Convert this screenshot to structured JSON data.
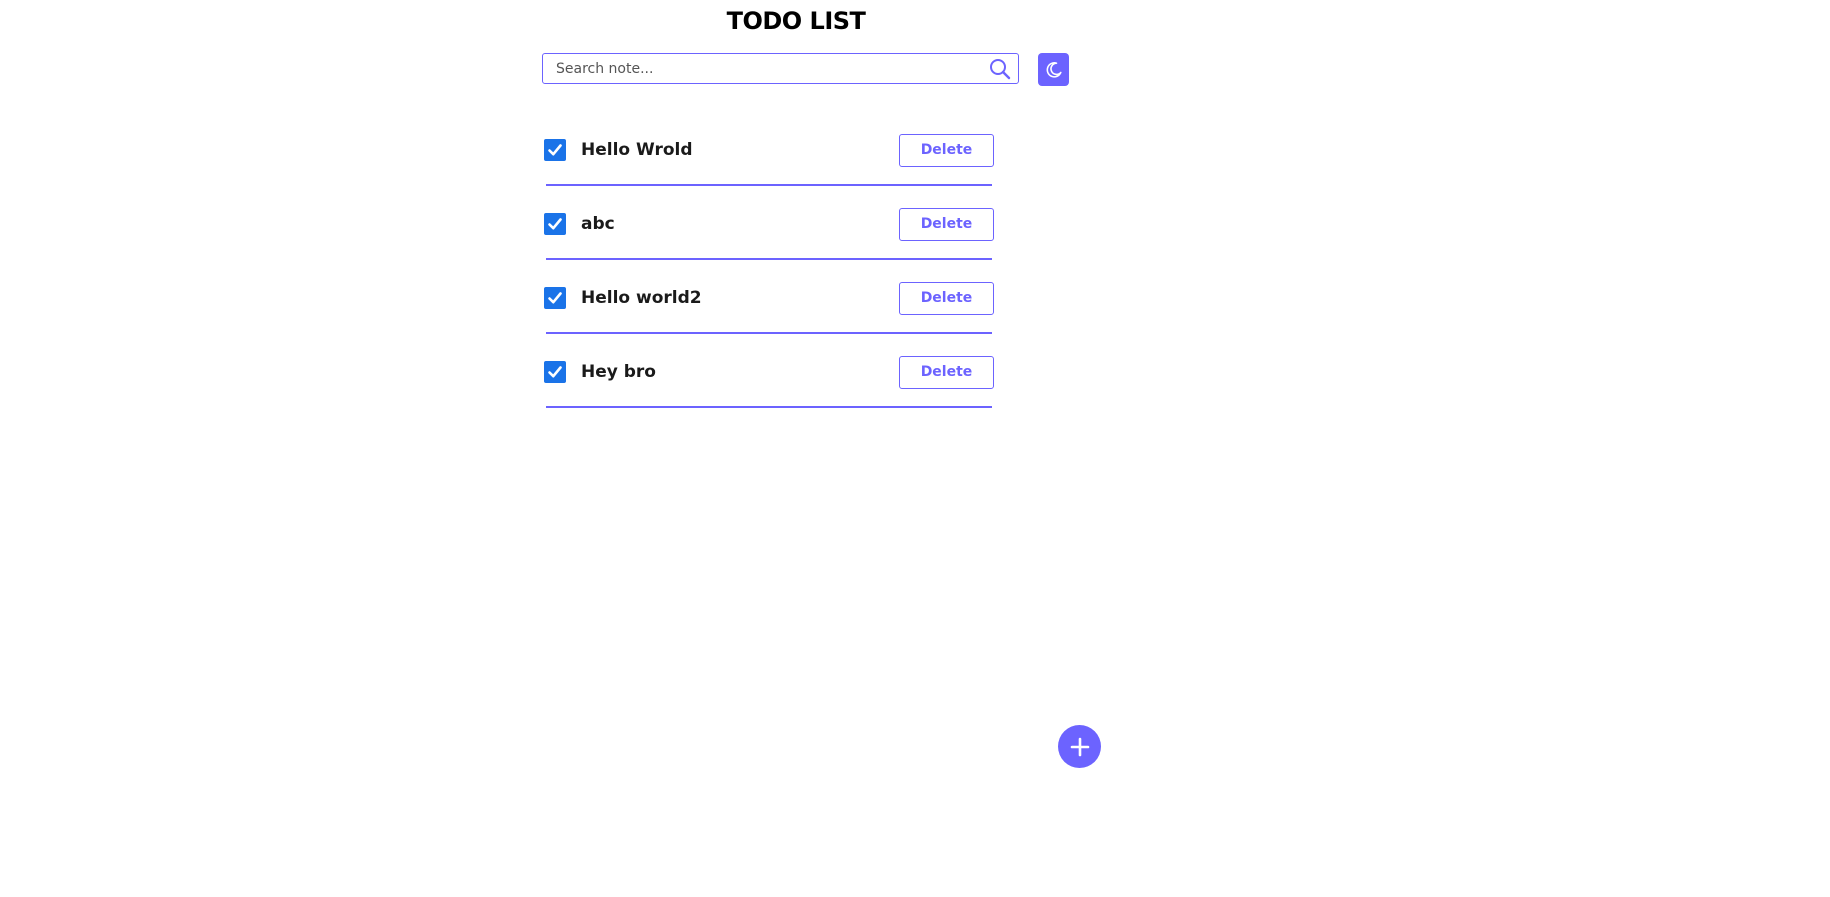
{
  "header": {
    "title": "TODO LIST"
  },
  "search": {
    "placeholder": "Search note...",
    "value": ""
  },
  "toolbar": {
    "theme_icon": "moon-icon",
    "search_icon": "search-icon"
  },
  "todos": [
    {
      "text": "Hello Wrold",
      "checked": true,
      "delete_label": "Delete"
    },
    {
      "text": "abc",
      "checked": true,
      "delete_label": "Delete"
    },
    {
      "text": "Hello world2",
      "checked": true,
      "delete_label": "Delete"
    },
    {
      "text": "Hey bro",
      "checked": true,
      "delete_label": "Delete"
    }
  ],
  "fab": {
    "icon": "plus-icon"
  },
  "colors": {
    "accent": "#6c63ff",
    "checkbox": "#1a73e8",
    "background": "#ffffff"
  }
}
